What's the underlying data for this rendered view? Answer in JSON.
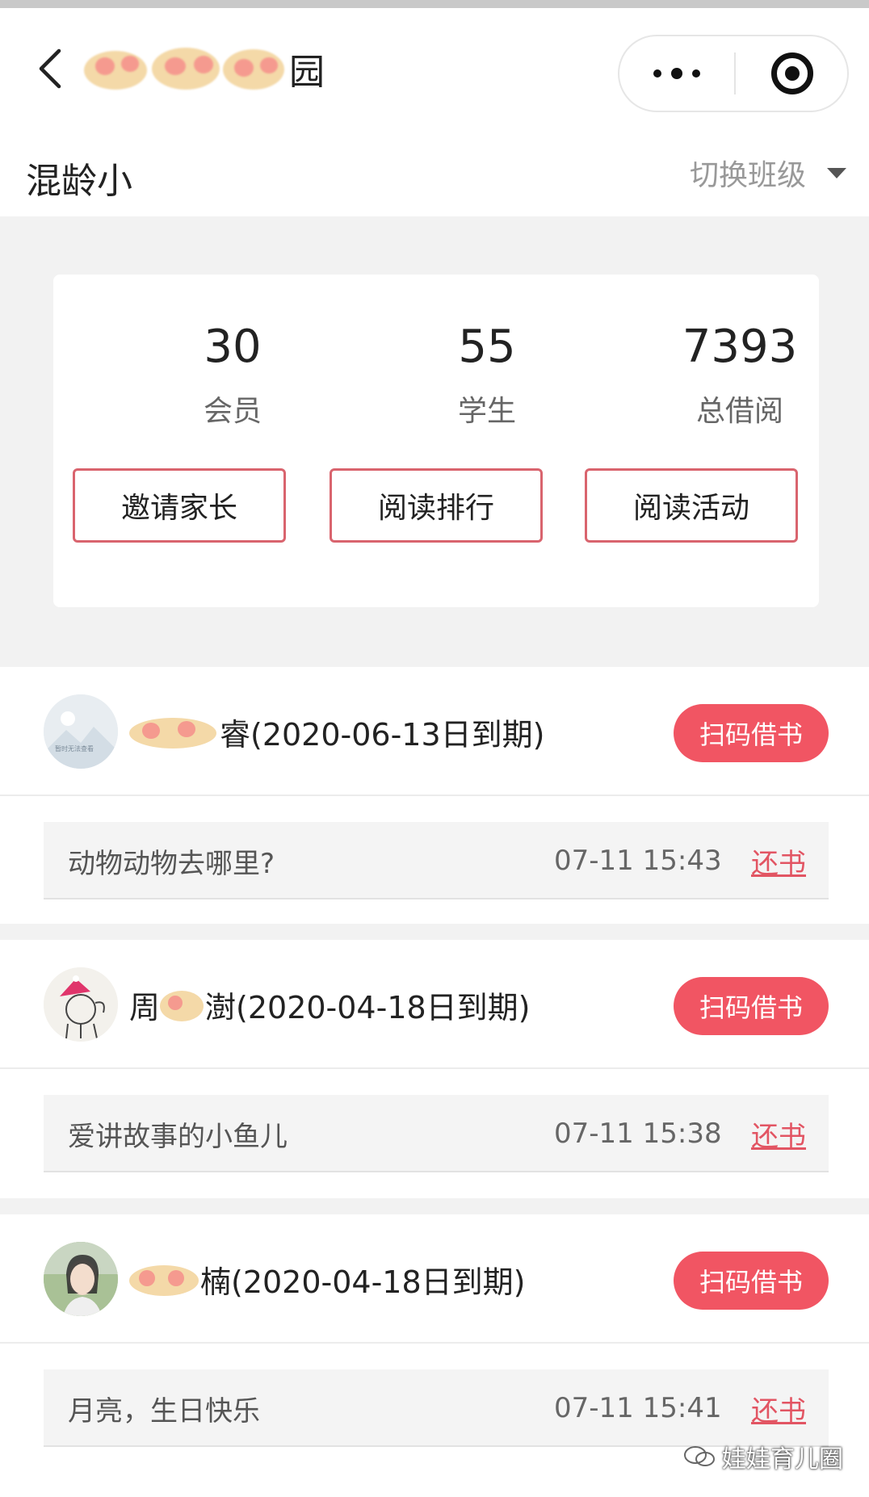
{
  "header": {
    "title_suffix": "园",
    "class_name": "混龄小",
    "switch_class_label": "切换班级"
  },
  "stats": [
    {
      "value": "30",
      "label": "会员"
    },
    {
      "value": "55",
      "label": "学生"
    },
    {
      "value": "7393",
      "label": "总借阅"
    }
  ],
  "actions": {
    "invite_parents": "邀请家长",
    "reading_rank": "阅读排行",
    "reading_activity": "阅读活动"
  },
  "records": [
    {
      "name_suffix": "睿(2020-06-13日到期)",
      "scan_label": "扫码借书",
      "avatar_text": "暂时无法查看",
      "book_title": "动物动物去哪里?",
      "time": "07-11 15:43",
      "return_label": "还书"
    },
    {
      "name_prefix": "周",
      "name_suffix": "澍(2020-04-18日到期)",
      "scan_label": "扫码借书",
      "book_title": "爱讲故事的小鱼儿",
      "time": "07-11 15:38",
      "return_label": "还书"
    },
    {
      "name_suffix": "楠(2020-04-18日到期)",
      "scan_label": "扫码借书",
      "book_title": "月亮，生日快乐",
      "time": "07-11 15:41",
      "return_label": "还书"
    }
  ],
  "watermark": "娃娃育儿圈",
  "colors": {
    "accent": "#f15563",
    "button_border": "#d9646e",
    "return_link": "#e25563"
  }
}
